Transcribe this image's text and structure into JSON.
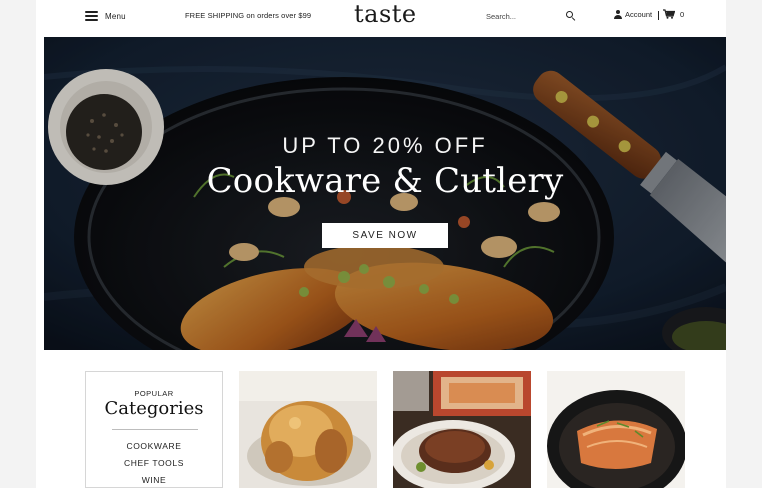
{
  "header": {
    "menu_label": "Menu",
    "promo_text": "FREE SHIPPING on orders over $99",
    "logo": "taste",
    "search_placeholder": "Search...",
    "account_label": "Account",
    "cart_count": "0"
  },
  "hero": {
    "kicker": "UP TO 20% OFF",
    "title": "Cookware & Cutlery",
    "cta_label": "SAVE NOW"
  },
  "categories": {
    "kicker": "POPULAR",
    "title": "Categories",
    "items": [
      "COOKWARE",
      "CHEF TOOLS",
      "WINE"
    ]
  },
  "tiles": [
    {
      "icon": "roast-chicken-photo"
    },
    {
      "icon": "steak-dish-photo"
    },
    {
      "icon": "salmon-skillet-photo"
    }
  ],
  "colors": {
    "hero_bg": "#15202e",
    "cta_bg": "#ffffff",
    "text": "#222222"
  }
}
